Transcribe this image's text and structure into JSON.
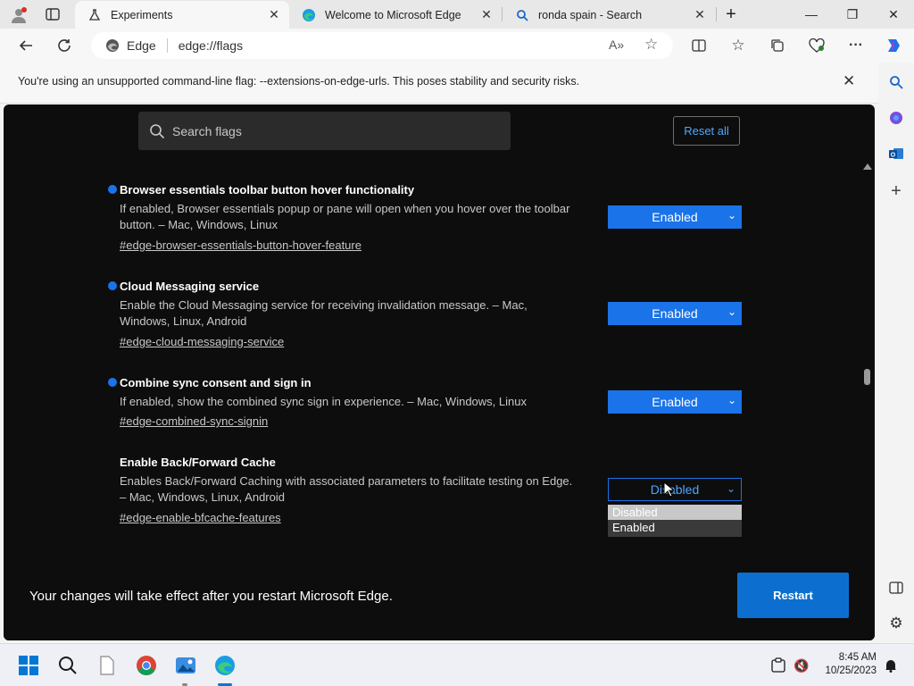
{
  "tabs": [
    {
      "title": "Experiments",
      "icon": "flask-icon",
      "active": true
    },
    {
      "title": "Welcome to Microsoft Edge",
      "icon": "edge-icon",
      "active": false
    },
    {
      "title": "ronda spain - Search",
      "icon": "search-icon",
      "active": false
    }
  ],
  "toolbar": {
    "site_label": "Edge",
    "url": "edge://flags"
  },
  "infobar": {
    "message": "You're using an unsupported command-line flag: --extensions-on-edge-urls. This poses stability and security risks."
  },
  "search": {
    "placeholder": "Search flags"
  },
  "reset_label": "Reset all",
  "flags": [
    {
      "title": "Browser essentials toolbar button hover functionality",
      "desc": "If enabled, Browser essentials popup or pane will open when you hover over the toolbar button. – Mac, Windows, Linux",
      "link": "#edge-browser-essentials-button-hover-feature",
      "value": "Enabled",
      "modified": true
    },
    {
      "title": "Cloud Messaging service",
      "desc": "Enable the Cloud Messaging service for receiving invalidation message. – Mac, Windows, Linux, Android",
      "link": "#edge-cloud-messaging-service",
      "value": "Enabled",
      "modified": true
    },
    {
      "title": "Combine sync consent and sign in",
      "desc": "If enabled, show the combined sync sign in experience. – Mac, Windows, Linux",
      "link": "#edge-combined-sync-signin",
      "value": "Enabled",
      "modified": true
    },
    {
      "title": "Enable Back/Forward Cache",
      "desc": "Enables Back/Forward Caching with associated parameters to facilitate testing on Edge. – Mac, Windows, Linux, Android",
      "link": "#edge-enable-bfcache-features",
      "value": "Disabled",
      "modified": false
    }
  ],
  "dropdown_options": [
    "Disabled",
    "Enabled"
  ],
  "footer": {
    "message": "Your changes will take effect after you restart Microsoft Edge.",
    "restart_label": "Restart"
  },
  "clock": {
    "time": "8:45 AM",
    "date": "10/25/2023"
  },
  "colors": {
    "accent": "#1a73e8",
    "page_bg": "#0d0d0d",
    "restart": "#0c6fd0"
  }
}
